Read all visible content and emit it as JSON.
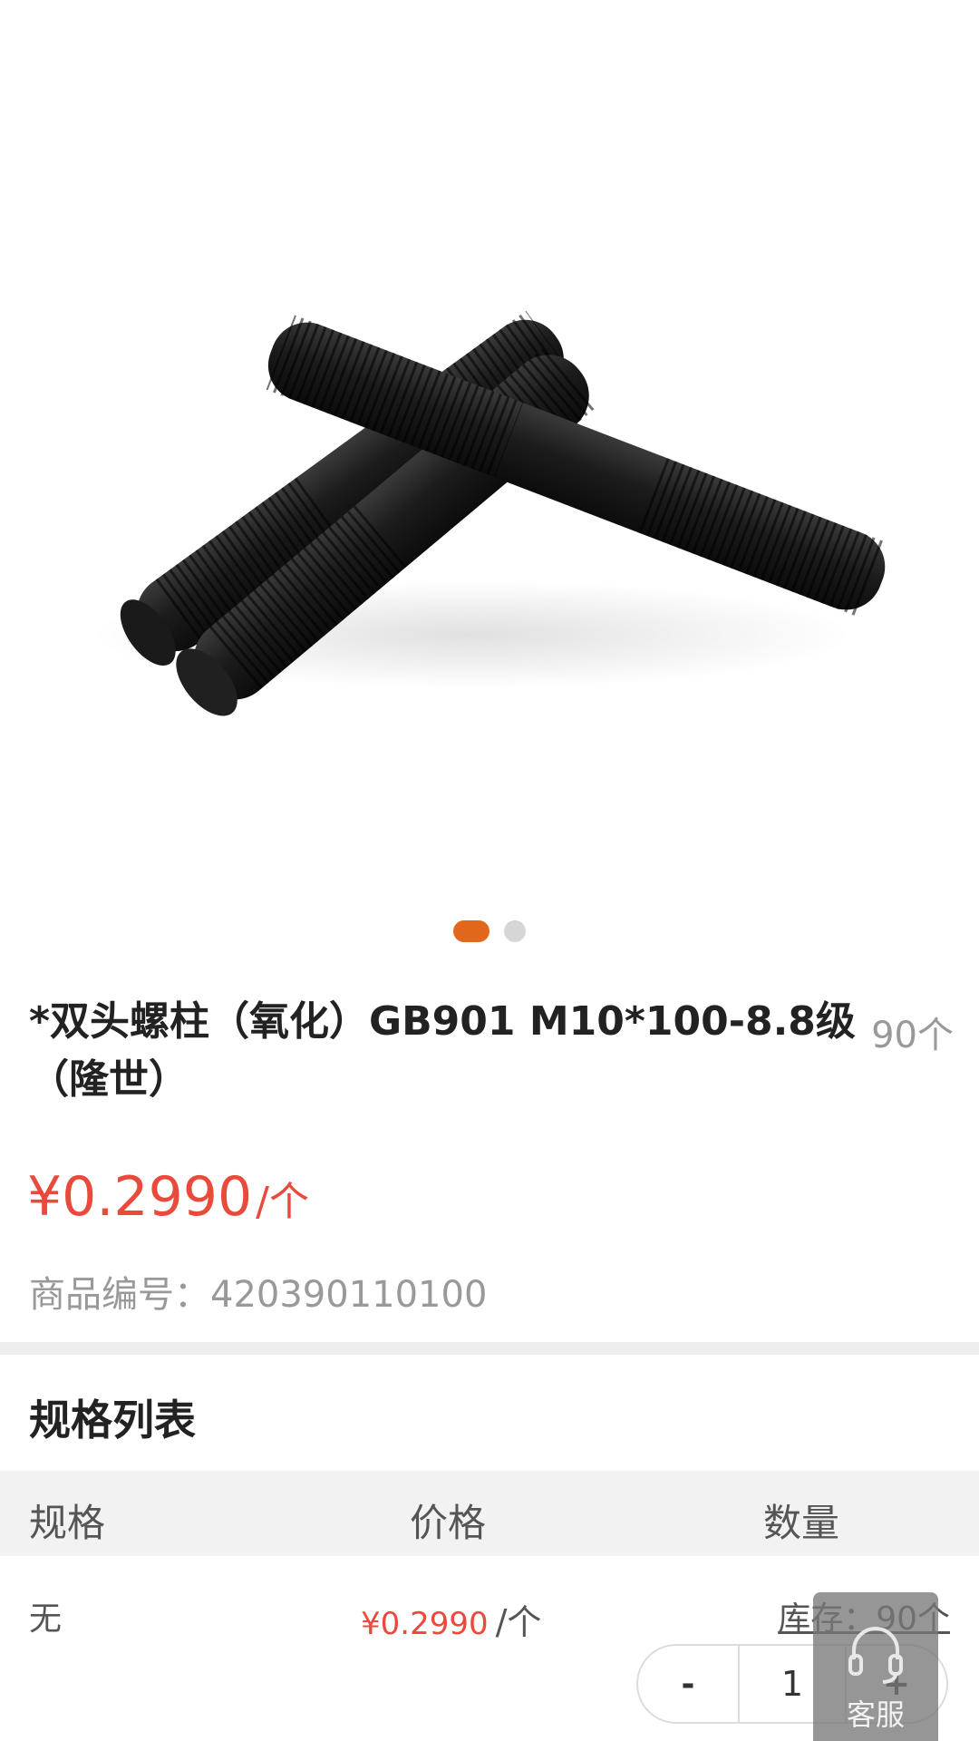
{
  "carousel": {
    "slide_count": 2,
    "active_index": 0,
    "image_alt": "double-end stud bolts product photo"
  },
  "product": {
    "title": "*双头螺柱（氧化）GB901 M10*100-8.8级（隆世）",
    "stock_badge": "90个",
    "price": "¥0.2990",
    "price_unit": "/个",
    "sku_label": "商品编号：",
    "sku_value": "420390110100"
  },
  "spec_section": {
    "title": "规格列表",
    "headers": [
      "规格",
      "价格",
      "数量"
    ],
    "rows": [
      {
        "spec": "无",
        "price": "¥0.2990",
        "unit": "/个",
        "stock": "库存：90个",
        "quantity": "1"
      }
    ],
    "stepper": {
      "minus": "-",
      "plus": "+"
    }
  },
  "floating": {
    "service_label": "客服"
  },
  "colors": {
    "accent": "#e2661b",
    "price": "#e94a3b",
    "muted": "#999999"
  }
}
